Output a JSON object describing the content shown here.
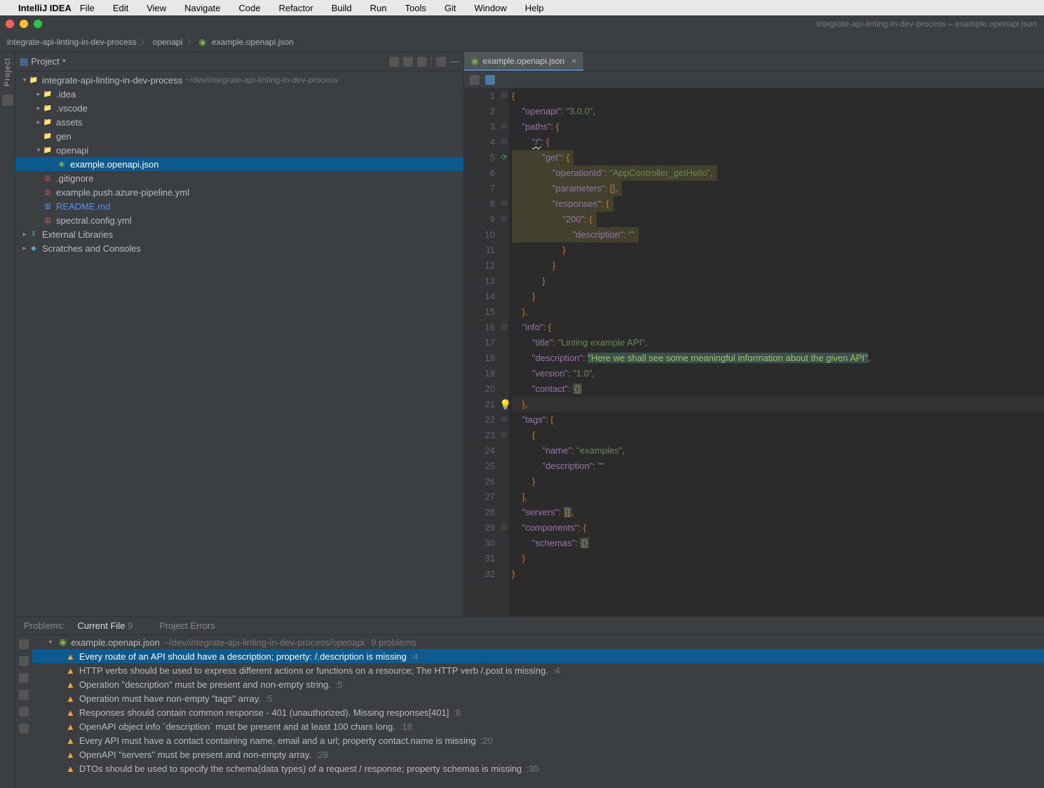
{
  "macos_menu": {
    "app": "IntelliJ IDEA",
    "items": [
      "File",
      "Edit",
      "View",
      "Navigate",
      "Code",
      "Refactor",
      "Build",
      "Run",
      "Tools",
      "Git",
      "Window",
      "Help"
    ]
  },
  "window_title": "integrate-api-linting-in-dev-process – example.openapi.json",
  "breadcrumbs": {
    "items": [
      "integrate-api-linting-in-dev-process",
      "openapi",
      "example.openapi.json"
    ]
  },
  "sidebar_toolwindow_label": "Project",
  "project_panel": {
    "title": "Project",
    "header_icons": [
      "target-icon",
      "sort-icon",
      "collapse-icon",
      "settings-icon",
      "minimize-icon"
    ]
  },
  "tree": [
    {
      "depth": 0,
      "chevron": "down",
      "icon": "folder",
      "name": "integrate-api-linting-in-dev-process",
      "hint": "~/dev/integrate-api-linting-in-dev-process"
    },
    {
      "depth": 1,
      "chevron": "right",
      "icon": "folder",
      "name": ".idea"
    },
    {
      "depth": 1,
      "chevron": "right",
      "icon": "folder",
      "name": ".vscode"
    },
    {
      "depth": 1,
      "chevron": "right",
      "icon": "folder",
      "name": "assets"
    },
    {
      "depth": 1,
      "chevron": "",
      "icon": "folder",
      "name": "gen"
    },
    {
      "depth": 1,
      "chevron": "down",
      "icon": "folder",
      "name": "openapi"
    },
    {
      "depth": 2,
      "chevron": "",
      "icon": "json",
      "name": "example.openapi.json",
      "selected": true
    },
    {
      "depth": 1,
      "chevron": "",
      "icon": "git",
      "name": ".gitignore"
    },
    {
      "depth": 1,
      "chevron": "",
      "icon": "yml",
      "name": "example.push.azure-pipeline.yml"
    },
    {
      "depth": 1,
      "chevron": "",
      "icon": "md",
      "name": "README.md",
      "link": true
    },
    {
      "depth": 1,
      "chevron": "",
      "icon": "yml",
      "name": "spectral.config.yml"
    },
    {
      "depth": 0,
      "chevron": "right",
      "icon": "lib",
      "name": "External Libraries"
    },
    {
      "depth": 0,
      "chevron": "right",
      "icon": "scratch",
      "name": "Scratches and Consoles"
    }
  ],
  "editor": {
    "tab_file": "example.openapi.json",
    "lines": [
      {
        "n": 1,
        "fold": "-",
        "hl": false,
        "raw": [
          [
            "punc",
            "{"
          ]
        ]
      },
      {
        "n": 2,
        "fold": "",
        "hl": false,
        "raw": [
          [
            "ws",
            "    "
          ],
          [
            "key",
            "\"openapi\""
          ],
          [
            "punc",
            ": "
          ],
          [
            "str",
            "\"3.0.0\""
          ],
          [
            "punc",
            ","
          ]
        ]
      },
      {
        "n": 3,
        "fold": "-",
        "hl": false,
        "raw": [
          [
            "ws",
            "    "
          ],
          [
            "key",
            "\"paths\""
          ],
          [
            "punc",
            ": {"
          ]
        ]
      },
      {
        "n": 4,
        "fold": "-",
        "hl": false,
        "raw": [
          [
            "ws",
            "        "
          ],
          [
            "keyU",
            "\"/\""
          ],
          [
            "punc",
            ": {"
          ]
        ]
      },
      {
        "n": 5,
        "fold": "-",
        "hl": true,
        "icon": "arrow",
        "raw": [
          [
            "ws",
            "            "
          ],
          [
            "key",
            "\"get\""
          ],
          [
            "punc",
            ": {"
          ]
        ]
      },
      {
        "n": 6,
        "fold": "",
        "hl": true,
        "raw": [
          [
            "ws",
            "                "
          ],
          [
            "key",
            "\"operationId\""
          ],
          [
            "punc",
            ": "
          ],
          [
            "str",
            "\"AppController_getHello\""
          ],
          [
            "punc",
            ","
          ]
        ]
      },
      {
        "n": 7,
        "fold": "",
        "hl": true,
        "raw": [
          [
            "ws",
            "                "
          ],
          [
            "key",
            "\"parameters\""
          ],
          [
            "punc",
            ": []"
          ],
          [
            "punc",
            ","
          ]
        ]
      },
      {
        "n": 8,
        "fold": "-",
        "hl": true,
        "raw": [
          [
            "ws",
            "                "
          ],
          [
            "key",
            "\"responses\""
          ],
          [
            "punc",
            ": {"
          ]
        ]
      },
      {
        "n": 9,
        "fold": "-",
        "hl": true,
        "raw": [
          [
            "ws",
            "                    "
          ],
          [
            "key",
            "\"200\""
          ],
          [
            "punc",
            ": {"
          ]
        ]
      },
      {
        "n": 10,
        "fold": "",
        "hl": true,
        "raw": [
          [
            "ws",
            "                        "
          ],
          [
            "key",
            "\"description\""
          ],
          [
            "punc",
            ": "
          ],
          [
            "str",
            "\"\""
          ]
        ]
      },
      {
        "n": 11,
        "fold": "",
        "hl": false,
        "raw": [
          [
            "ws",
            "                    "
          ],
          [
            "punc",
            "}"
          ]
        ]
      },
      {
        "n": 12,
        "fold": "",
        "hl": false,
        "raw": [
          [
            "ws",
            "                "
          ],
          [
            "punc",
            "}"
          ]
        ]
      },
      {
        "n": 13,
        "fold": "",
        "hl": false,
        "raw": [
          [
            "ws",
            "            "
          ],
          [
            "punc",
            "}"
          ]
        ]
      },
      {
        "n": 14,
        "fold": "",
        "hl": false,
        "raw": [
          [
            "ws",
            "        "
          ],
          [
            "punc",
            "}"
          ]
        ]
      },
      {
        "n": 15,
        "fold": "",
        "hl": false,
        "raw": [
          [
            "ws",
            "    "
          ],
          [
            "punc",
            "},"
          ]
        ]
      },
      {
        "n": 16,
        "fold": "-",
        "hl": false,
        "raw": [
          [
            "ws",
            "    "
          ],
          [
            "key",
            "\"info\""
          ],
          [
            "punc",
            ": {"
          ]
        ]
      },
      {
        "n": 17,
        "fold": "",
        "hl": false,
        "raw": [
          [
            "ws",
            "        "
          ],
          [
            "key",
            "\"title\""
          ],
          [
            "punc",
            ": "
          ],
          [
            "str",
            "\"Linting example API\""
          ],
          [
            "punc",
            ","
          ]
        ]
      },
      {
        "n": 18,
        "fold": "",
        "hl": false,
        "raw": [
          [
            "ws",
            "        "
          ],
          [
            "key",
            "\"description\""
          ],
          [
            "punc",
            ": "
          ],
          [
            "desc",
            "\"Here we shall see some meaningful information about the given API\""
          ],
          [
            "punc",
            ","
          ]
        ]
      },
      {
        "n": 19,
        "fold": "",
        "hl": false,
        "raw": [
          [
            "ws",
            "        "
          ],
          [
            "key",
            "\"version\""
          ],
          [
            "punc",
            ": "
          ],
          [
            "str",
            "\"1.0\""
          ],
          [
            "punc",
            ","
          ]
        ]
      },
      {
        "n": 20,
        "fold": "",
        "hl": false,
        "raw": [
          [
            "ws",
            "        "
          ],
          [
            "key",
            "\"contact\""
          ],
          [
            "punc",
            ": "
          ],
          [
            "box",
            "{}"
          ]
        ]
      },
      {
        "n": 21,
        "fold": "",
        "hl": false,
        "current": true,
        "icon": "bulb",
        "raw": [
          [
            "ws",
            "    "
          ],
          [
            "punc",
            "},"
          ]
        ]
      },
      {
        "n": 22,
        "fold": "-",
        "hl": false,
        "raw": [
          [
            "ws",
            "    "
          ],
          [
            "key",
            "\"tags\""
          ],
          [
            "punc",
            ": ["
          ]
        ]
      },
      {
        "n": 23,
        "fold": "-",
        "hl": false,
        "raw": [
          [
            "ws",
            "        "
          ],
          [
            "punc",
            "{"
          ]
        ]
      },
      {
        "n": 24,
        "fold": "",
        "hl": false,
        "raw": [
          [
            "ws",
            "            "
          ],
          [
            "key",
            "\"name\""
          ],
          [
            "punc",
            ": "
          ],
          [
            "str",
            "\"examples\""
          ],
          [
            "punc",
            ","
          ]
        ]
      },
      {
        "n": 25,
        "fold": "",
        "hl": false,
        "raw": [
          [
            "ws",
            "            "
          ],
          [
            "key",
            "\"description\""
          ],
          [
            "punc",
            ": "
          ],
          [
            "str",
            "\"\""
          ]
        ]
      },
      {
        "n": 26,
        "fold": "",
        "hl": false,
        "raw": [
          [
            "ws",
            "        "
          ],
          [
            "punc",
            "}"
          ]
        ]
      },
      {
        "n": 27,
        "fold": "",
        "hl": false,
        "raw": [
          [
            "ws",
            "    "
          ],
          [
            "punc",
            "],"
          ]
        ]
      },
      {
        "n": 28,
        "fold": "",
        "hl": false,
        "raw": [
          [
            "ws",
            "    "
          ],
          [
            "key",
            "\"servers\""
          ],
          [
            "punc",
            ": "
          ],
          [
            "box",
            "[]"
          ],
          [
            "punc",
            ","
          ]
        ]
      },
      {
        "n": 29,
        "fold": "-",
        "hl": false,
        "raw": [
          [
            "ws",
            "    "
          ],
          [
            "key",
            "\"components\""
          ],
          [
            "punc",
            ": {"
          ]
        ]
      },
      {
        "n": 30,
        "fold": "",
        "hl": false,
        "raw": [
          [
            "ws",
            "        "
          ],
          [
            "key",
            "\"schemas\""
          ],
          [
            "punc",
            ": "
          ],
          [
            "box",
            "{}"
          ]
        ]
      },
      {
        "n": 31,
        "fold": "",
        "hl": false,
        "raw": [
          [
            "ws",
            "    "
          ],
          [
            "punc",
            "}"
          ]
        ]
      },
      {
        "n": 32,
        "fold": "",
        "hl": false,
        "raw": [
          [
            "punc",
            "}"
          ]
        ]
      }
    ]
  },
  "problems": {
    "tabs_label": "Problems:",
    "tabs": [
      {
        "label": "Current File",
        "count": "9",
        "active": true
      },
      {
        "label": "Project Errors",
        "active": false
      }
    ],
    "file_header": {
      "name": "example.openapi.json",
      "path": "~/dev/integrate-api-linting-in-dev-process/openapi",
      "count": "9 problems"
    },
    "items": [
      {
        "msg": "Every route of an API should have a description; property: /.description is missing",
        "loc": ":4",
        "selected": true
      },
      {
        "msg": "HTTP verbs should be used to express different actions or functions on a resource; The HTTP verb /.post is missing.",
        "loc": ":4"
      },
      {
        "msg": "Operation \"description\" must be present and non-empty string.",
        "loc": ":5"
      },
      {
        "msg": "Operation must have non-empty \"tags\" array.",
        "loc": ":5"
      },
      {
        "msg": "Responses should contain common response - 401 (unauthorized). Missing responses[401]",
        "loc": ":8"
      },
      {
        "msg": "OpenAPI object info `description` must be present and at least 100 chars long.",
        "loc": ":18"
      },
      {
        "msg": "Every API must have a contact containing name, email and a url; property contact.name is missing",
        "loc": ":20"
      },
      {
        "msg": "OpenAPI \"servers\" must be present and non-empty array.",
        "loc": ":28"
      },
      {
        "msg": "DTOs should be used to specify the schema(data types) of a request / response; property schemas is missing",
        "loc": ":30"
      }
    ]
  }
}
